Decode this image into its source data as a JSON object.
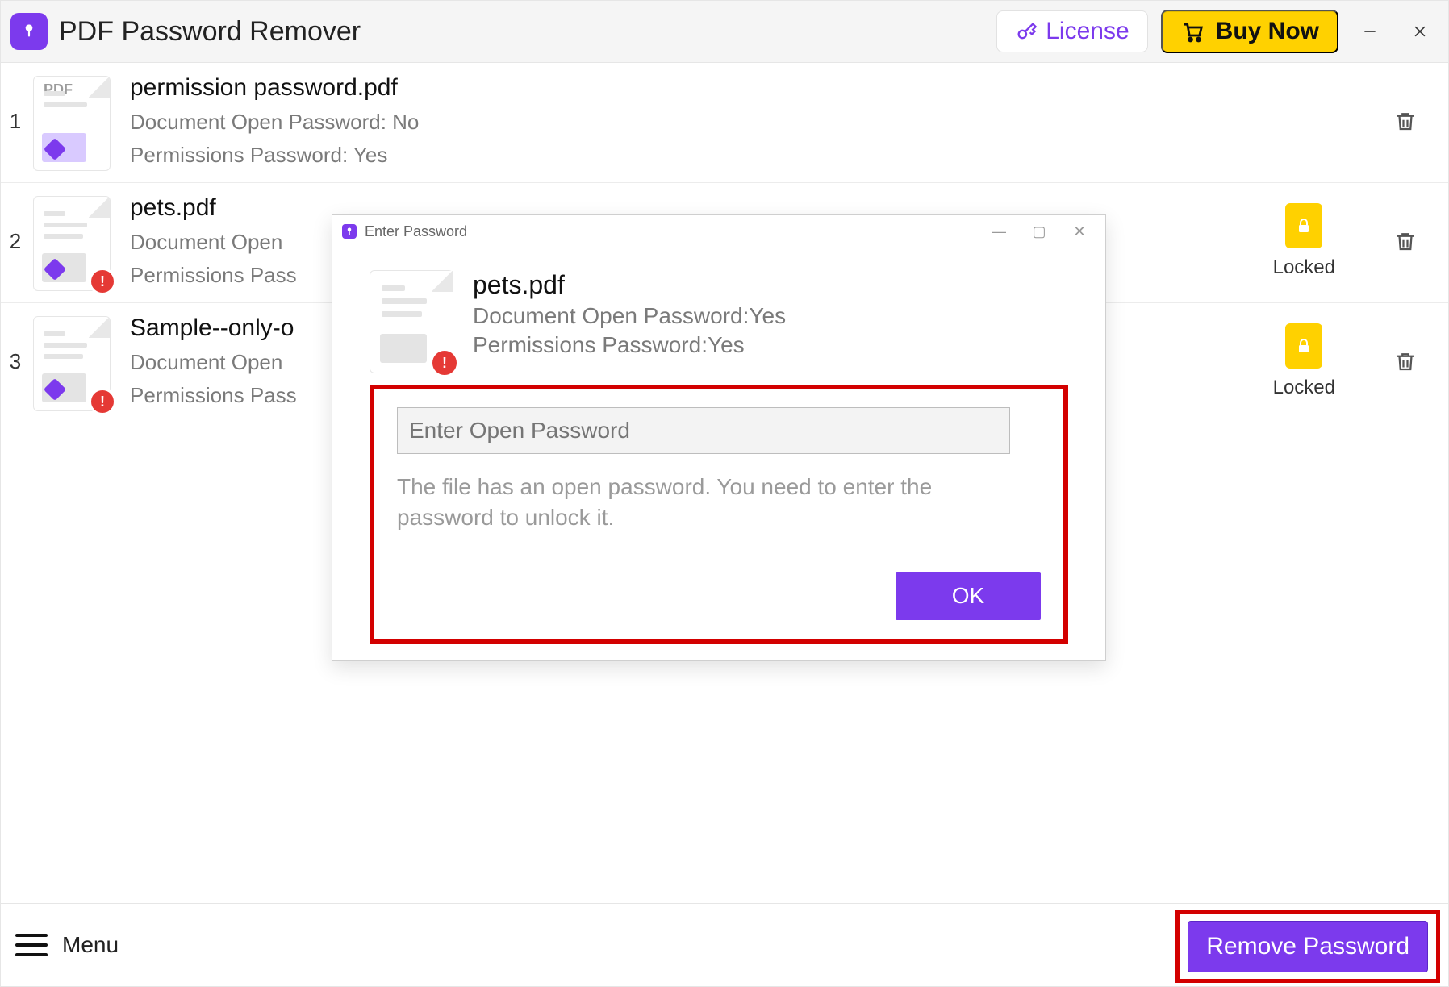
{
  "titlebar": {
    "app_title": "PDF Password Remover",
    "license_label": "License",
    "buy_label": "Buy Now"
  },
  "files": [
    {
      "index": "1",
      "name": "permission password.pdf",
      "open_line": "Document Open Password: No",
      "perm_line": "Permissions Password: Yes",
      "locked": false,
      "alert": false,
      "pdf_tag": "PDF"
    },
    {
      "index": "2",
      "name": "pets.pdf",
      "open_line": "Document Open",
      "perm_line": "Permissions Pass",
      "locked": true,
      "locked_label": "Locked",
      "alert": true
    },
    {
      "index": "3",
      "name": "Sample--only-o",
      "open_line": "Document Open",
      "perm_line": "Permissions Pass",
      "locked": true,
      "locked_label": "Locked",
      "alert": true
    }
  ],
  "dialog": {
    "title": "Enter Password",
    "file_name": "pets.pdf",
    "open_line": "Document Open Password:Yes",
    "perm_line": "Permissions Password:Yes",
    "input_placeholder": "Enter Open Password",
    "help_text": "The file has an open password. You need to enter the password to unlock it.",
    "ok_label": "OK"
  },
  "bottom": {
    "menu_label": "Menu",
    "remove_label": "Remove Password"
  }
}
